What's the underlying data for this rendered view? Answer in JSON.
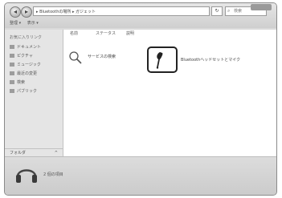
{
  "window": {
    "address": "▸ Bluetoothの場所 ▸ ガジェット",
    "refresh": "↻",
    "search_placeholder": "検索"
  },
  "toolbar": {
    "organize": "整理 ▾",
    "view": "表示 ▾"
  },
  "sidebar": {
    "favorites": "お気に入りリンク",
    "items": [
      {
        "label": "ドキュメント"
      },
      {
        "label": "ピクチャ"
      },
      {
        "label": "ミュージック"
      },
      {
        "label": "最近の変更"
      },
      {
        "label": "検索"
      },
      {
        "label": "パブリック"
      }
    ],
    "folders_label": "フォルダ",
    "folders_chevron": "^"
  },
  "columns": {
    "name": "名前",
    "status": "ステータス",
    "category": "説明"
  },
  "items": {
    "search_service": "サービスの検索",
    "headset": "Bluetoothヘッドセットとマイク"
  },
  "status": {
    "count": "2 個の項目"
  }
}
